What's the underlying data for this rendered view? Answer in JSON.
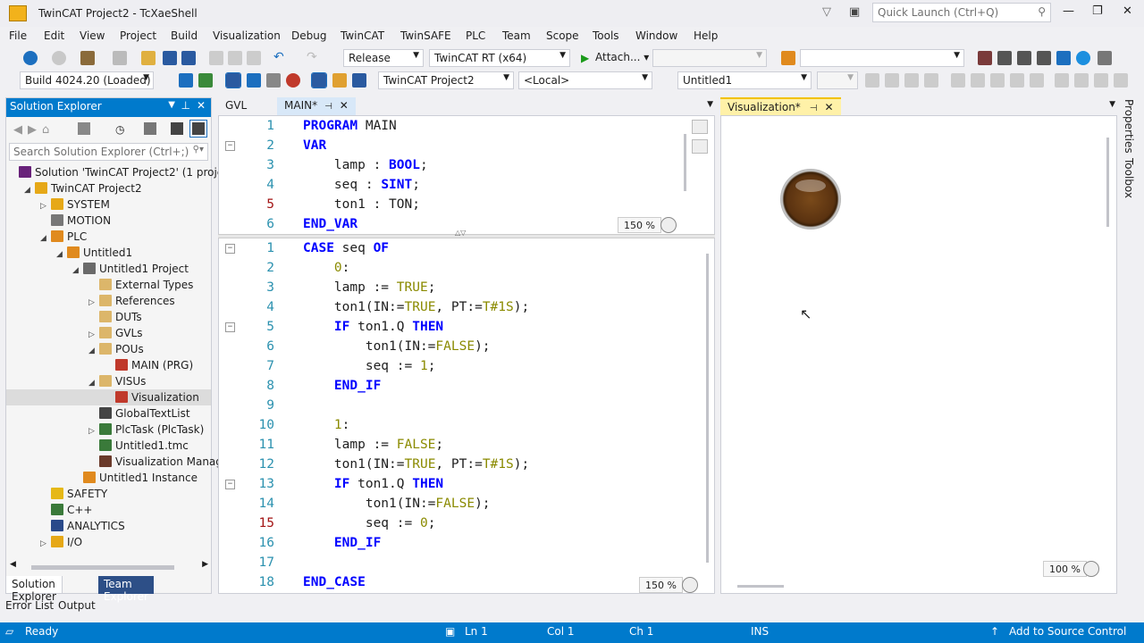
{
  "window": {
    "title": "TwinCAT Project2 - TcXaeShell",
    "quick_launch": "Quick Launch (Ctrl+Q)"
  },
  "menu": [
    "File",
    "Edit",
    "View",
    "Project",
    "Build",
    "Visualization",
    "Debug",
    "TwinCAT",
    "TwinSAFE",
    "PLC",
    "Team",
    "Scope",
    "Tools",
    "Window",
    "Help"
  ],
  "toolbar": {
    "config": "Release",
    "platform": "TwinCAT RT (x64)",
    "attach": "Attach...",
    "build": "Build 4024.20 (Loaded)",
    "project": "TwinCAT Project2",
    "target": "<Local>",
    "plc": "Untitled1"
  },
  "solution_explorer": {
    "title": "Solution Explorer",
    "search_placeholder": "Search Solution Explorer (Ctrl+;)",
    "tree": [
      {
        "label": "Solution 'TwinCAT Project2' (1 project)",
        "indent": 0,
        "exp": "",
        "color": "#68217a"
      },
      {
        "label": "TwinCAT Project2",
        "indent": 1,
        "exp": "◢",
        "color": "#e6a817"
      },
      {
        "label": "SYSTEM",
        "indent": 2,
        "exp": "▷",
        "color": "#e6a817"
      },
      {
        "label": "MOTION",
        "indent": 2,
        "exp": "",
        "color": "#777777"
      },
      {
        "label": "PLC",
        "indent": 2,
        "exp": "◢",
        "color": "#e08a1e"
      },
      {
        "label": "Untitled1",
        "indent": 3,
        "exp": "◢",
        "color": "#e08a1e"
      },
      {
        "label": "Untitled1 Project",
        "indent": 4,
        "exp": "◢",
        "color": "#6a6a6a"
      },
      {
        "label": "External Types",
        "indent": 5,
        "exp": "",
        "color": "#dcb66a"
      },
      {
        "label": "References",
        "indent": 5,
        "exp": "▷",
        "color": "#dcb66a"
      },
      {
        "label": "DUTs",
        "indent": 5,
        "exp": "",
        "color": "#dcb66a"
      },
      {
        "label": "GVLs",
        "indent": 5,
        "exp": "▷",
        "color": "#dcb66a"
      },
      {
        "label": "POUs",
        "indent": 5,
        "exp": "◢",
        "color": "#dcb66a"
      },
      {
        "label": "MAIN (PRG)",
        "indent": 6,
        "exp": "",
        "color": "#c0392b"
      },
      {
        "label": "VISUs",
        "indent": 5,
        "exp": "◢",
        "color": "#dcb66a"
      },
      {
        "label": "Visualization",
        "indent": 6,
        "exp": "",
        "color": "#c0392b",
        "selected": true
      },
      {
        "label": "GlobalTextList",
        "indent": 5,
        "exp": "",
        "color": "#444444"
      },
      {
        "label": "PlcTask (PlcTask)",
        "indent": 5,
        "exp": "▷",
        "color": "#3a7a3a"
      },
      {
        "label": "Untitled1.tmc",
        "indent": 5,
        "exp": "",
        "color": "#3a7a3a"
      },
      {
        "label": "Visualization Manager",
        "indent": 5,
        "exp": "",
        "color": "#6a3a2a"
      },
      {
        "label": "Untitled1 Instance",
        "indent": 4,
        "exp": "",
        "color": "#e08a1e"
      },
      {
        "label": "SAFETY",
        "indent": 2,
        "exp": "",
        "color": "#e6b817"
      },
      {
        "label": "C++",
        "indent": 2,
        "exp": "",
        "color": "#3a7a3a"
      },
      {
        "label": "ANALYTICS",
        "indent": 2,
        "exp": "",
        "color": "#2a4a8a"
      },
      {
        "label": "I/O",
        "indent": 2,
        "exp": "▷",
        "color": "#e6a817"
      }
    ],
    "tab_solution": "Solution Explorer",
    "tab_team": "Team Explorer"
  },
  "editor": {
    "tabs": [
      "GVL",
      "MAIN*"
    ],
    "decl_zoom": "150 %",
    "body_zoom": "150 %",
    "decl": [
      {
        "n": "1",
        "parts": [
          [
            "kw",
            "PROGRAM"
          ],
          [
            "t",
            " MAIN"
          ]
        ]
      },
      {
        "n": "2",
        "fold": true,
        "parts": [
          [
            "kw",
            "VAR"
          ]
        ]
      },
      {
        "n": "3",
        "parts": [
          [
            "t",
            "    lamp : "
          ],
          [
            "kw",
            "BOOL"
          ],
          [
            "t",
            ";"
          ]
        ]
      },
      {
        "n": "4",
        "parts": [
          [
            "t",
            "    seq : "
          ],
          [
            "kw",
            "SINT"
          ],
          [
            "t",
            ";"
          ]
        ]
      },
      {
        "n": "5",
        "mod": true,
        "parts": [
          [
            "t",
            "    ton1 : TON;"
          ]
        ]
      },
      {
        "n": "6",
        "parts": [
          [
            "kw",
            "END_VAR"
          ]
        ]
      }
    ],
    "body": [
      {
        "n": "1",
        "fold": true,
        "parts": [
          [
            "kw",
            "CASE"
          ],
          [
            "t",
            " seq "
          ],
          [
            "kw",
            "OF"
          ]
        ]
      },
      {
        "n": "2",
        "parts": [
          [
            "t",
            "    "
          ],
          [
            "lit",
            "0"
          ],
          [
            "t",
            ":"
          ]
        ]
      },
      {
        "n": "3",
        "parts": [
          [
            "t",
            "    lamp := "
          ],
          [
            "lit",
            "TRUE"
          ],
          [
            "t",
            ";"
          ]
        ]
      },
      {
        "n": "4",
        "parts": [
          [
            "t",
            "    ton1(IN:="
          ],
          [
            "lit",
            "TRUE"
          ],
          [
            "t",
            ", PT:="
          ],
          [
            "lit",
            "T#1S"
          ],
          [
            "t",
            ");"
          ]
        ]
      },
      {
        "n": "5",
        "fold": true,
        "parts": [
          [
            "t",
            "    "
          ],
          [
            "kw",
            "IF"
          ],
          [
            "t",
            " ton1.Q "
          ],
          [
            "kw",
            "THEN"
          ]
        ]
      },
      {
        "n": "6",
        "parts": [
          [
            "t",
            "        ton1(IN:="
          ],
          [
            "lit",
            "FALSE"
          ],
          [
            "t",
            ");"
          ]
        ]
      },
      {
        "n": "7",
        "parts": [
          [
            "t",
            "        seq := "
          ],
          [
            "lit",
            "1"
          ],
          [
            "t",
            ";"
          ]
        ]
      },
      {
        "n": "8",
        "parts": [
          [
            "t",
            "    "
          ],
          [
            "kw",
            "END_IF"
          ]
        ]
      },
      {
        "n": "9",
        "parts": []
      },
      {
        "n": "10",
        "parts": [
          [
            "t",
            "    "
          ],
          [
            "lit",
            "1"
          ],
          [
            "t",
            ":"
          ]
        ]
      },
      {
        "n": "11",
        "parts": [
          [
            "t",
            "    lamp := "
          ],
          [
            "lit",
            "FALSE"
          ],
          [
            "t",
            ";"
          ]
        ]
      },
      {
        "n": "12",
        "parts": [
          [
            "t",
            "    ton1(IN:="
          ],
          [
            "lit",
            "TRUE"
          ],
          [
            "t",
            ", PT:="
          ],
          [
            "lit",
            "T#1S"
          ],
          [
            "t",
            ");"
          ]
        ]
      },
      {
        "n": "13",
        "fold": true,
        "parts": [
          [
            "t",
            "    "
          ],
          [
            "kw",
            "IF"
          ],
          [
            "t",
            " ton1.Q "
          ],
          [
            "kw",
            "THEN"
          ]
        ]
      },
      {
        "n": "14",
        "parts": [
          [
            "t",
            "        ton1(IN:="
          ],
          [
            "lit",
            "FALSE"
          ],
          [
            "t",
            ");"
          ]
        ]
      },
      {
        "n": "15",
        "mod": true,
        "parts": [
          [
            "t",
            "        seq := "
          ],
          [
            "lit",
            "0"
          ],
          [
            "t",
            ";"
          ]
        ]
      },
      {
        "n": "16",
        "parts": [
          [
            "t",
            "    "
          ],
          [
            "kw",
            "END_IF"
          ]
        ]
      },
      {
        "n": "17",
        "parts": []
      },
      {
        "n": "18",
        "parts": [
          [
            "kw",
            "END_CASE"
          ]
        ]
      }
    ]
  },
  "visu": {
    "tab": "Visualization*",
    "zoom": "100 %"
  },
  "right_sidebar": [
    "Properties",
    "Toolbox"
  ],
  "bottom_tabs": [
    "Error List",
    "Output"
  ],
  "status": {
    "ready": "Ready",
    "ln": "Ln 1",
    "col": "Col 1",
    "ch": "Ch 1",
    "ins": "INS",
    "source": "Add to Source Control"
  }
}
